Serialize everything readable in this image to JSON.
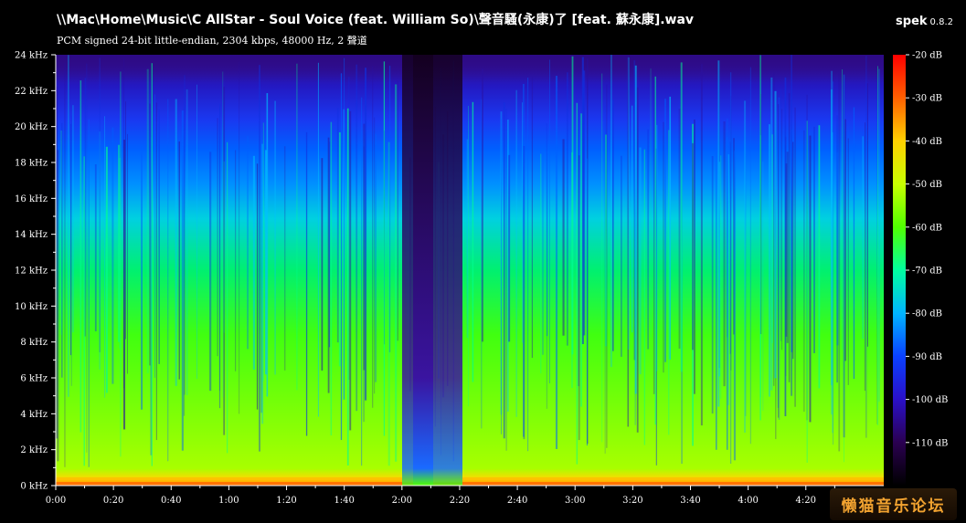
{
  "header": {
    "title": "\\\\Mac\\Home\\Music\\C AllStar - Soul Voice (feat. William So)\\聲音騷(永康)了 [feat. 蘇永康].wav",
    "subtitle": "PCM signed 24-bit little-endian, 2304 kbps, 48000 Hz, 2 聲道",
    "app_name": "spek",
    "app_version": "0.8.2"
  },
  "watermark": {
    "text": "懒猫音乐论坛"
  },
  "chart_data": {
    "type": "heatmap",
    "title": "",
    "xlabel": "",
    "ylabel": "",
    "x_ticks": [
      "0:00",
      "0:20",
      "0:40",
      "1:00",
      "1:20",
      "1:40",
      "2:00",
      "2:20",
      "2:40",
      "3:00",
      "3:20",
      "3:40",
      "4:00",
      "4:20"
    ],
    "y_ticks": [
      "0 kHz",
      "2 kHz",
      "4 kHz",
      "6 kHz",
      "8 kHz",
      "10 kHz",
      "12 kHz",
      "14 kHz",
      "16 kHz",
      "18 kHz",
      "20 kHz",
      "22 kHz",
      "24 kHz"
    ],
    "xlim": [
      0,
      287
    ],
    "ylim": [
      0,
      24
    ],
    "colorbar": {
      "labels": [
        "-20 dB",
        "-30 dB",
        "-40 dB",
        "-50 dB",
        "-60 dB",
        "-70 dB",
        "-80 dB",
        "-90 dB",
        "-100 dB",
        "-110 dB"
      ],
      "range": [
        -120,
        -20
      ],
      "colors": [
        "#000000",
        "#2a0050",
        "#2a10c8",
        "#0a40ff",
        "#00b4ff",
        "#00ffa0",
        "#50ff00",
        "#c8ff00",
        "#ffd000",
        "#ff6000",
        "#ff0000"
      ]
    }
  }
}
